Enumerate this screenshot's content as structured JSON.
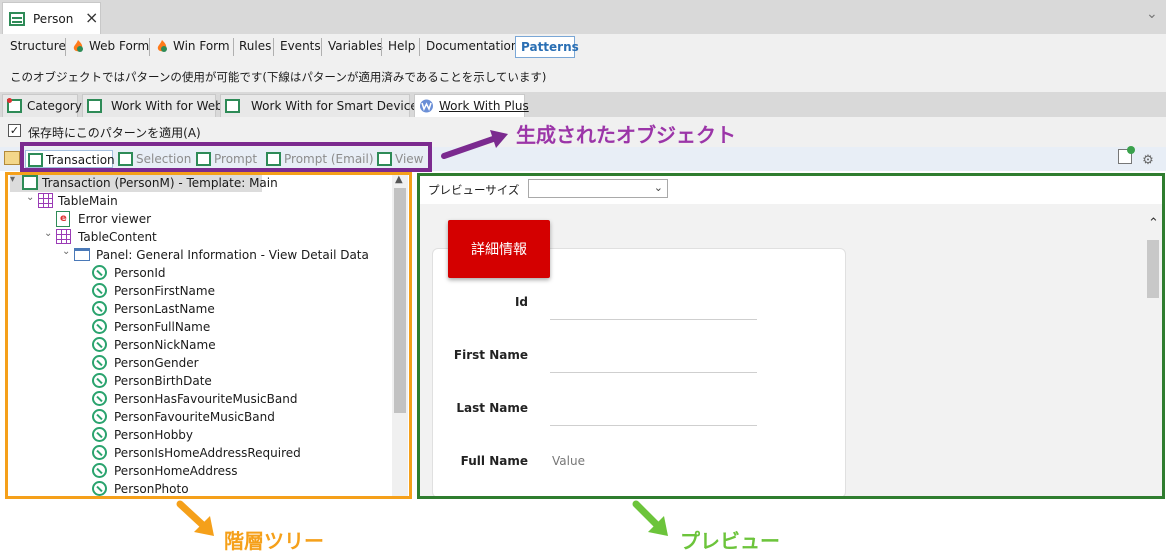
{
  "document_tab": {
    "title": "Person"
  },
  "sections": {
    "items": [
      "Structure",
      "Web Form",
      "Win Form",
      "Rules",
      "Events",
      "Variables",
      "Help",
      "Documentation"
    ],
    "active": "Patterns"
  },
  "notice": "このオブジェクトではパターンの使用が可能です(下線はパターンが適用済みであることを示しています)",
  "pattern_tabs": [
    "Category",
    "Work With for Web",
    "Work With for Smart Devices",
    "Work With Plus"
  ],
  "apply_on_save": {
    "checked": true,
    "label": "保存時にこのパターンを適用(A)"
  },
  "generated_objects": [
    "Transaction",
    "Selection",
    "Prompt",
    "Prompt (Email)",
    "View"
  ],
  "tree": {
    "root": "Transaction (PersonM) - Template: Main",
    "table_main": "TableMain",
    "error_viewer": "Error viewer",
    "table_content": "TableContent",
    "panel": "Panel: General Information - View Detail Data",
    "fields": [
      "PersonId",
      "PersonFirstName",
      "PersonLastName",
      "PersonFullName",
      "PersonNickName",
      "PersonGender",
      "PersonBirthDate",
      "PersonHasFavouriteMusicBand",
      "PersonFavouriteMusicBand",
      "PersonHobby",
      "PersonIsHomeAddressRequired",
      "PersonHomeAddress",
      "PersonPhoto"
    ]
  },
  "preview": {
    "size_label": "プレビューサイズ",
    "size_value": "",
    "badge": "詳細情報",
    "fields": [
      {
        "label": "Id",
        "value": ""
      },
      {
        "label": "First Name",
        "value": ""
      },
      {
        "label": "Last Name",
        "value": ""
      },
      {
        "label": "Full Name",
        "value": "Value"
      }
    ]
  },
  "annotations": {
    "generated_objects": "生成されたオブジェクト",
    "hierarchy_tree": "階層ツリー",
    "preview": "プレビュー"
  },
  "colors": {
    "purple": "#7b2a8f",
    "orange": "#f5a01a",
    "green": "#2f7d2f",
    "badge_red": "#d40000",
    "active_blue": "#2a6fb4"
  },
  "icons": [
    "close-icon",
    "chevron-down-icon",
    "transaction-icon",
    "flame-icon",
    "checkbox-icon",
    "settings-icon",
    "table-icon",
    "field-icon",
    "panel-icon",
    "error-viewer-icon"
  ]
}
